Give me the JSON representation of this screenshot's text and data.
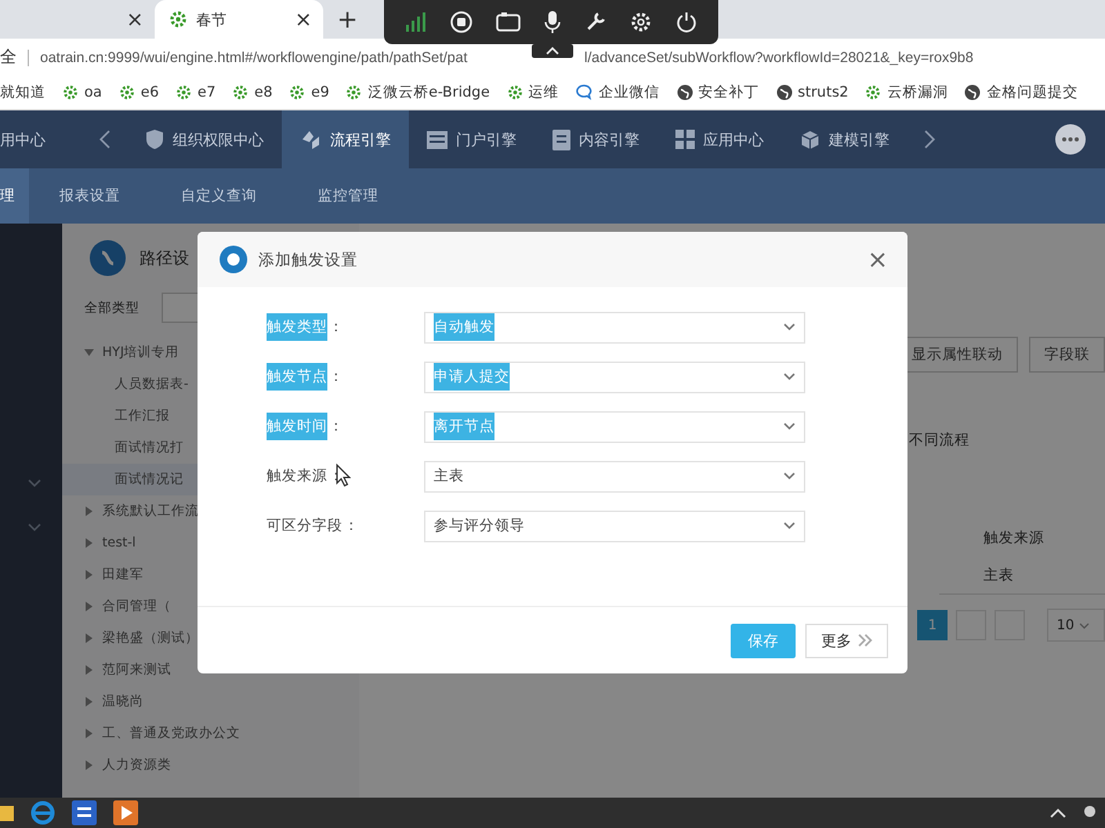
{
  "browser": {
    "tabs": [
      {
        "close": "×",
        "selected": false
      },
      {
        "title": "春节",
        "close": "×",
        "selected": true
      }
    ],
    "new_tab": "+",
    "address": {
      "prefix": "全",
      "url_parts": [
        "oatrain.cn:9999/wui/engine.html#/workflowengine/path/pathSet/pat",
        "l/advanceSet/subWorkflow?workflowId=28021&_key=rox9b8"
      ]
    },
    "bookmarks": [
      {
        "label": "就知道",
        "kind": "none"
      },
      {
        "label": "oa",
        "kind": "gear"
      },
      {
        "label": "e6",
        "kind": "gear"
      },
      {
        "label": "e7",
        "kind": "gear"
      },
      {
        "label": "e8",
        "kind": "gear"
      },
      {
        "label": "e9",
        "kind": "gear"
      },
      {
        "label": "泛微云桥e-Bridge",
        "kind": "gear"
      },
      {
        "label": "运维",
        "kind": "gear"
      },
      {
        "label": "企业微信",
        "kind": "chat"
      },
      {
        "label": "安全补丁",
        "kind": "globe"
      },
      {
        "label": "struts2",
        "kind": "globe"
      },
      {
        "label": "云桥漏洞",
        "kind": "gear"
      },
      {
        "label": "金格问题提交",
        "kind": "globe"
      }
    ]
  },
  "top_nav": [
    {
      "label": "用中心",
      "kind": "none",
      "selected": false
    },
    {
      "label": "组织权限中心",
      "kind": "shield",
      "selected": false
    },
    {
      "label": "流程引擎",
      "kind": "flow",
      "selected": true
    },
    {
      "label": "门户引擎",
      "kind": "window",
      "selected": false
    },
    {
      "label": "内容引擎",
      "kind": "doc",
      "selected": false
    },
    {
      "label": "应用中心",
      "kind": "grid",
      "selected": false
    },
    {
      "label": "建模引擎",
      "kind": "cube",
      "selected": false
    }
  ],
  "sub_nav": [
    {
      "label": "理",
      "selected": true
    },
    {
      "label": "报表设置",
      "selected": false
    },
    {
      "label": "自定义查询",
      "selected": false
    },
    {
      "label": "监控管理",
      "selected": false
    }
  ],
  "tree_panel": {
    "title": "路径设",
    "filter_label": "全部类型",
    "items": [
      {
        "label": "HYJ培训专用",
        "expanded": true,
        "selected": false,
        "children": [
          {
            "label": "人员数据表-",
            "selected": false
          },
          {
            "label": "工作汇报",
            "selected": false
          },
          {
            "label": "面试情况打",
            "selected": false
          },
          {
            "label": "面试情况记",
            "selected": true
          }
        ]
      },
      {
        "label": "系统默认工作流",
        "expanded": false,
        "selected": false
      },
      {
        "label": "test-l",
        "expanded": false,
        "selected": false
      },
      {
        "label": "田建军",
        "expanded": false,
        "selected": false
      },
      {
        "label": "合同管理（",
        "expanded": false,
        "selected": false
      },
      {
        "label": "梁艳盛（测试）",
        "expanded": false,
        "selected": false
      },
      {
        "label": "范阿来测试",
        "expanded": false,
        "selected": false
      },
      {
        "label": "温晓尚",
        "expanded": false,
        "selected": false
      },
      {
        "label": "工、普通及党政办公文",
        "expanded": false,
        "selected": false
      },
      {
        "label": "人力资源类",
        "expanded": false,
        "selected": false
      }
    ]
  },
  "content": {
    "buttons": [
      "显示属性联动",
      "字段联"
    ],
    "note": "不同流程",
    "table": {
      "columns": [
        "触发来源"
      ],
      "rows": [
        [
          "主表"
        ]
      ]
    },
    "pagination": {
      "pages": [
        {
          "label": "1",
          "selected": true
        }
      ],
      "page_size": "10"
    }
  },
  "dialog": {
    "title": "添加触发设置",
    "close": "×",
    "fields": [
      {
        "label": "触发类型",
        "suffix": "：",
        "value": "自动触发",
        "highlighted": true
      },
      {
        "label": "触发节点",
        "suffix": "：",
        "value": "申请人提交",
        "highlighted": true
      },
      {
        "label": "触发时间",
        "suffix": "：",
        "value": "离开节点",
        "highlighted": true
      },
      {
        "label": "触发来源",
        "suffix": "：",
        "value": "主表",
        "highlighted": false
      },
      {
        "label": "可区分字段",
        "suffix": "：",
        "value": "参与评分领导",
        "highlighted": false
      }
    ],
    "buttons": [
      {
        "label": "保存",
        "kind": "primary"
      },
      {
        "label": "更多",
        "kind": "more"
      }
    ]
  }
}
